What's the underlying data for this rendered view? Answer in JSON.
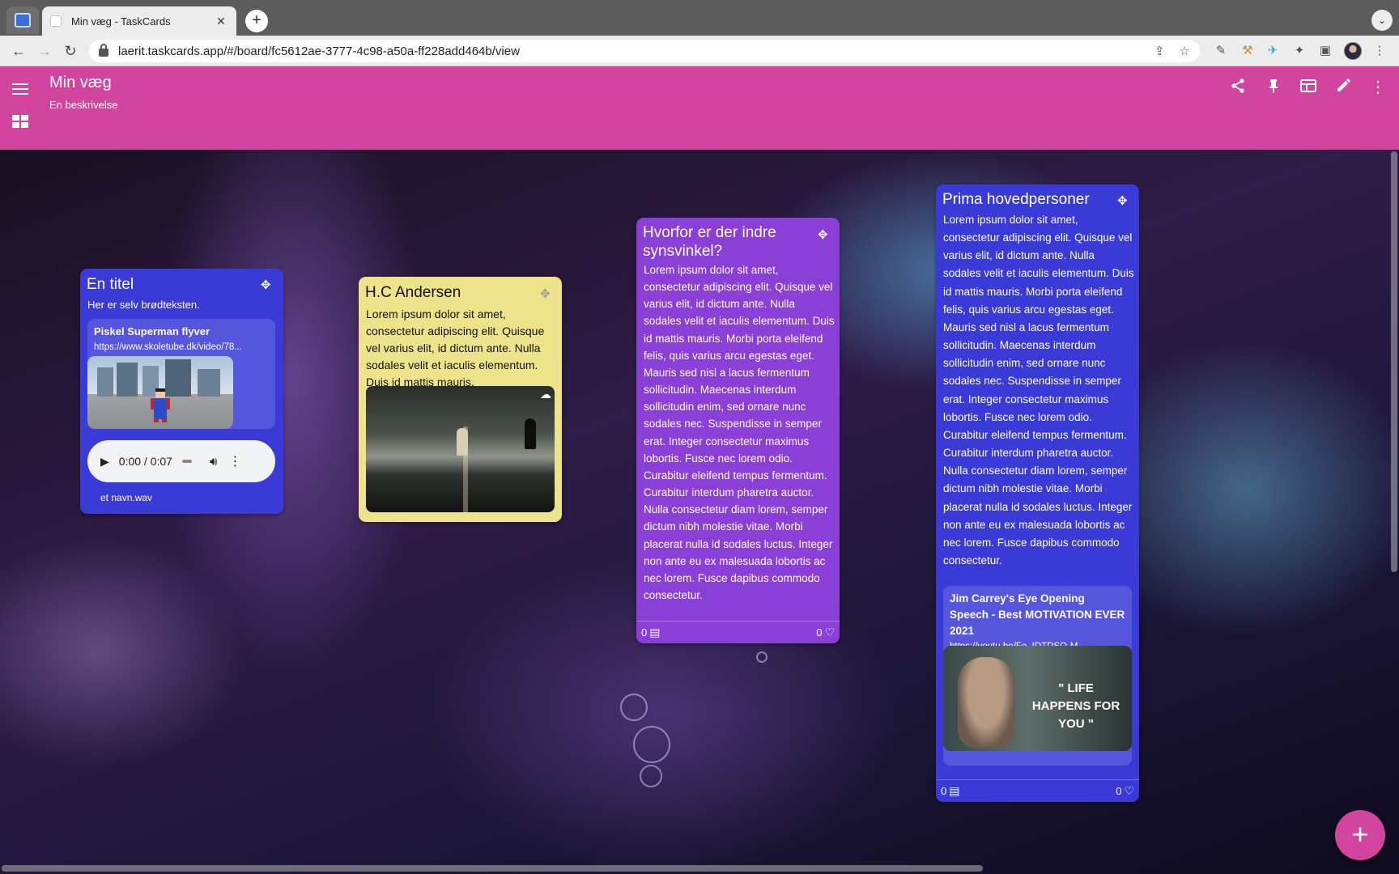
{
  "browser": {
    "tab_title": "Min væg - TaskCards",
    "url": "laerit.taskcards.app/#/board/fc5612ae-3777-4c98-a50a-ff228add464b/view"
  },
  "header": {
    "title": "Min væg",
    "description": "En beskrivelse",
    "color": "#d2459f"
  },
  "cards": {
    "c1": {
      "title": "En titel",
      "text": "Her er selv brødteksten.",
      "link_title": "Piskel Superman flyver",
      "link_url": "https://www.skoletube.dk/video/78...",
      "audio_time": "0:00 / 0:07",
      "audio_file": "et navn.wav",
      "color": "#3a3bd6"
    },
    "c2": {
      "title": "H.C Andersen",
      "text": "Lorem ipsum dolor sit amet, consectetur adipiscing elit. Quisque vel varius elit, id dictum ante. Nulla sodales velit et iaculis elementum. Duis id mattis mauris.",
      "color": "#ede38a"
    },
    "c3": {
      "title": "Hvorfor er der indre synsvinkel?",
      "text": "Lorem ipsum dolor sit amet, consectetur adipiscing elit. Quisque vel varius elit, id dictum ante. Nulla sodales velit et iaculis elementum. Duis id mattis mauris. Morbi porta eleifend felis, quis varius arcu egestas eget. Mauris sed nisl a lacus fermentum sollicitudin. Maecenas interdum sollicitudin enim, sed ornare nunc sodales nec. Suspendisse in semper erat. Integer consectetur maximus lobortis. Fusce nec lorem odio. Curabitur eleifend tempus fermentum. Curabitur interdum pharetra auctor. Nulla consectetur diam lorem, semper dictum nibh molestie vitae. Morbi placerat nulla id sodales luctus. Integer non ante eu ex malesuada lobortis ac nec lorem. Fusce dapibus commodo consectetur.",
      "comments": "0",
      "likes": "0",
      "color": "#8a3fd6"
    },
    "c4": {
      "title": "Prima hovedpersoner",
      "text": "Lorem ipsum dolor sit amet, consectetur adipiscing elit. Quisque vel varius elit, id dictum ante. Nulla sodales velit et iaculis elementum. Duis id mattis mauris. Morbi porta eleifend felis, quis varius arcu egestas eget. Mauris sed nisl a lacus fermentum sollicitudin. Maecenas interdum sollicitudin enim, sed ornare nunc sodales nec. Suspendisse in semper erat. Integer consectetur maximus lobortis. Fusce nec lorem odio. Curabitur eleifend tempus fermentum. Curabitur interdum pharetra auctor. Nulla consectetur diam lorem, semper dictum nibh molestie vitae. Morbi placerat nulla id sodales luctus. Integer non ante eu ex malesuada lobortis ac nec lorem. Fusce dapibus commodo consectetur.",
      "link_title": "Jim Carrey's Eye Opening Speech - Best MOTIVATION EVER 2021",
      "link_url": "https://youtu.be/Fo_IDTDSO-M",
      "thumb_text": "\" LIFE HAPPENS FOR YOU \"",
      "comments": "0",
      "likes": "0",
      "color": "#3a3bd6"
    }
  }
}
